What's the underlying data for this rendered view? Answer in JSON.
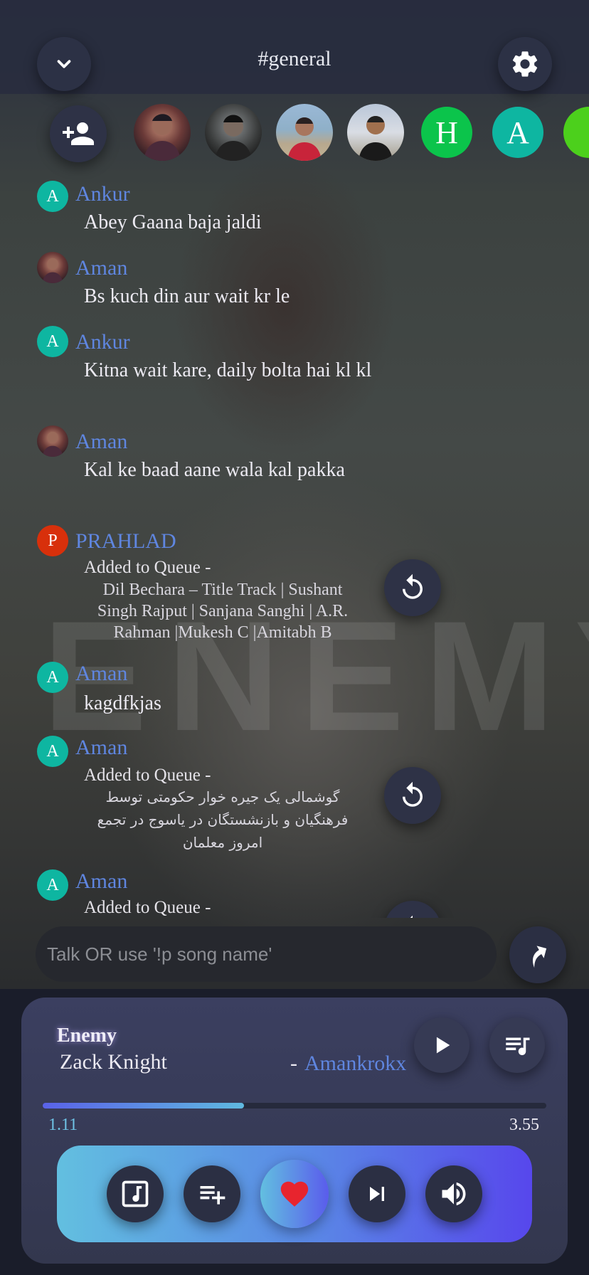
{
  "header": {
    "title": "#general"
  },
  "icons": {
    "collapse": "chevron-down-icon",
    "settings": "gear-icon",
    "invite": "add-user-icon",
    "retry": "replay-icon",
    "send": "send-icon"
  },
  "members": [
    {
      "kind": "photo",
      "name": "member-1"
    },
    {
      "kind": "photo",
      "name": "member-2"
    },
    {
      "kind": "photo",
      "name": "member-3"
    },
    {
      "kind": "photo",
      "name": "member-4"
    },
    {
      "kind": "letter",
      "letter": "H",
      "color": "#0bc44b"
    },
    {
      "kind": "letter",
      "letter": "A",
      "color": "#0eb6a1"
    },
    {
      "kind": "partial",
      "color": "#4cd01c"
    }
  ],
  "messages": [
    {
      "initial": "A",
      "avatar_color": "#0eb6a1",
      "name": "Ankur",
      "text": "Abey Gaana baja jaldi"
    },
    {
      "initial": "",
      "avatar_color": "#7a2a2a",
      "name": "Aman",
      "text": "Bs kuch din aur wait kr le"
    },
    {
      "initial": "A",
      "avatar_color": "#0eb6a1",
      "name": "Ankur",
      "text": "Kitna wait kare, daily bolta hai kl kl"
    },
    {
      "initial": "",
      "avatar_color": "#7a2a2a",
      "name": "Aman",
      "text": "Kal ke baad aane wala kal pakka"
    },
    {
      "initial": "P",
      "avatar_color": "#d8300b",
      "name": "PRAHLAD",
      "queue_label": "Added to Queue -",
      "song": "Dil Bechara – Title Track | Sushant Singh Rajput | Sanjana Sanghi | A.R. Rahman |Mukesh C |Amitabh B"
    },
    {
      "initial": "A",
      "avatar_color": "#0eb6a1",
      "name": "Aman",
      "text": "kagdfkjas"
    },
    {
      "initial": "A",
      "avatar_color": "#0eb6a1",
      "name": "Aman",
      "queue_label": "Added to Queue -",
      "song": "گوشمالی یک جیره خوار حکومتی توسط فرهنگیان و بازنشستگان در یاسوج در تجمع امروز معلمان"
    },
    {
      "initial": "A",
      "avatar_color": "#0eb6a1",
      "name": "Aman",
      "queue_label": "Added to Queue -"
    }
  ],
  "input": {
    "placeholder": "Talk OR use '!p song name'"
  },
  "player": {
    "title": "Enemy",
    "artist": "Zack Knight",
    "separator": "-",
    "requested_by": "Amankrokx",
    "current_time": "1.11",
    "total_time": "3.55",
    "progress": 0.4,
    "liked": true
  },
  "colors": {
    "accent_blue": "#5f86e0",
    "heart": "#e8242e",
    "progress_start": "#5a62e8",
    "progress_end": "#5fb9e0"
  }
}
